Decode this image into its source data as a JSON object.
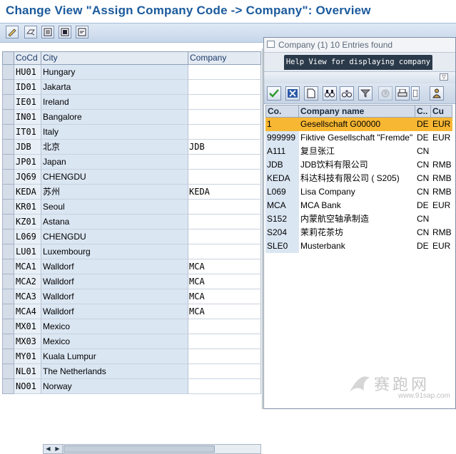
{
  "window": {
    "title": "Change View \"Assign Company Code -> Company\": Overview"
  },
  "toolbar": {
    "buttons": [
      "edit-glasses-icon",
      "change-toggle-icon",
      "select-all-icon",
      "select-block-icon",
      "deselect-icon"
    ]
  },
  "main_table": {
    "columns": [
      "CoCd",
      "City",
      "Company"
    ],
    "rows": [
      {
        "cocd": "HU01",
        "city": "Hungary",
        "company": ""
      },
      {
        "cocd": "ID01",
        "city": "Jakarta",
        "company": ""
      },
      {
        "cocd": "IE01",
        "city": "Ireland",
        "company": ""
      },
      {
        "cocd": "IN01",
        "city": "Bangalore",
        "company": ""
      },
      {
        "cocd": "IT01",
        "city": "Italy",
        "company": ""
      },
      {
        "cocd": "JDB",
        "city": "北京",
        "company": "JDB"
      },
      {
        "cocd": "JP01",
        "city": "Japan",
        "company": ""
      },
      {
        "cocd": "JQ69",
        "city": "CHENGDU",
        "company": ""
      },
      {
        "cocd": "KEDA",
        "city": "苏州",
        "company": "KEDA"
      },
      {
        "cocd": "KR01",
        "city": "Seoul",
        "company": ""
      },
      {
        "cocd": "KZ01",
        "city": "Astana",
        "company": ""
      },
      {
        "cocd": "L069",
        "city": "CHENGDU",
        "company": ""
      },
      {
        "cocd": "LU01",
        "city": "Luxembourg",
        "company": ""
      },
      {
        "cocd": "MCA1",
        "city": "Walldorf",
        "company": "MCA"
      },
      {
        "cocd": "MCA2",
        "city": "Walldorf",
        "company": "MCA"
      },
      {
        "cocd": "MCA3",
        "city": "Walldorf",
        "company": "MCA"
      },
      {
        "cocd": "MCA4",
        "city": "Walldorf",
        "company": "MCA"
      },
      {
        "cocd": "MX01",
        "city": "Mexico",
        "company": ""
      },
      {
        "cocd": "MX03",
        "city": "Mexico",
        "company": ""
      },
      {
        "cocd": "MY01",
        "city": "Kuala Lumpur",
        "company": ""
      },
      {
        "cocd": "NL01",
        "city": "The Netherlands",
        "company": ""
      },
      {
        "cocd": "NO01",
        "city": "Norway",
        "company": ""
      }
    ]
  },
  "popup": {
    "title": "Company (1)   10 Entries found",
    "tab_label": "Help View for displaying company",
    "columns": [
      "Co.",
      "Company name",
      "C..",
      "Cu"
    ],
    "rows": [
      {
        "co": "1",
        "name": "Gesellschaft G00000",
        "c": "DE",
        "cu": "EUR"
      },
      {
        "co": "999999",
        "name": "Fiktive Gesellschaft \"Fremde\"",
        "c": "DE",
        "cu": "EUR"
      },
      {
        "co": "A111",
        "name": "复旦张江",
        "c": "CN",
        "cu": ""
      },
      {
        "co": "JDB",
        "name": "JDB饮料有限公司",
        "c": "CN",
        "cu": "RMB"
      },
      {
        "co": "KEDA",
        "name": "科达科技有限公司 ( S205)",
        "c": "CN",
        "cu": "RMB"
      },
      {
        "co": "L069",
        "name": "Lisa Company",
        "c": "CN",
        "cu": "RMB"
      },
      {
        "co": "MCA",
        "name": "MCA Bank",
        "c": "DE",
        "cu": "EUR"
      },
      {
        "co": "S152",
        "name": "内蒙航空轴承制造",
        "c": "CN",
        "cu": ""
      },
      {
        "co": "S204",
        "name": "茉莉花茶坊",
        "c": "CN",
        "cu": "RMB"
      },
      {
        "co": "SLE0",
        "name": "Musterbank",
        "c": "DE",
        "cu": "EUR"
      }
    ],
    "highlighted_row": 0,
    "boxed_row": 5
  },
  "watermark": {
    "text": "赛跑网",
    "url": "www.91sap.com"
  },
  "colors": {
    "title": "#1a5a9c",
    "highlight": "#f7b733",
    "box": "#d04040"
  }
}
